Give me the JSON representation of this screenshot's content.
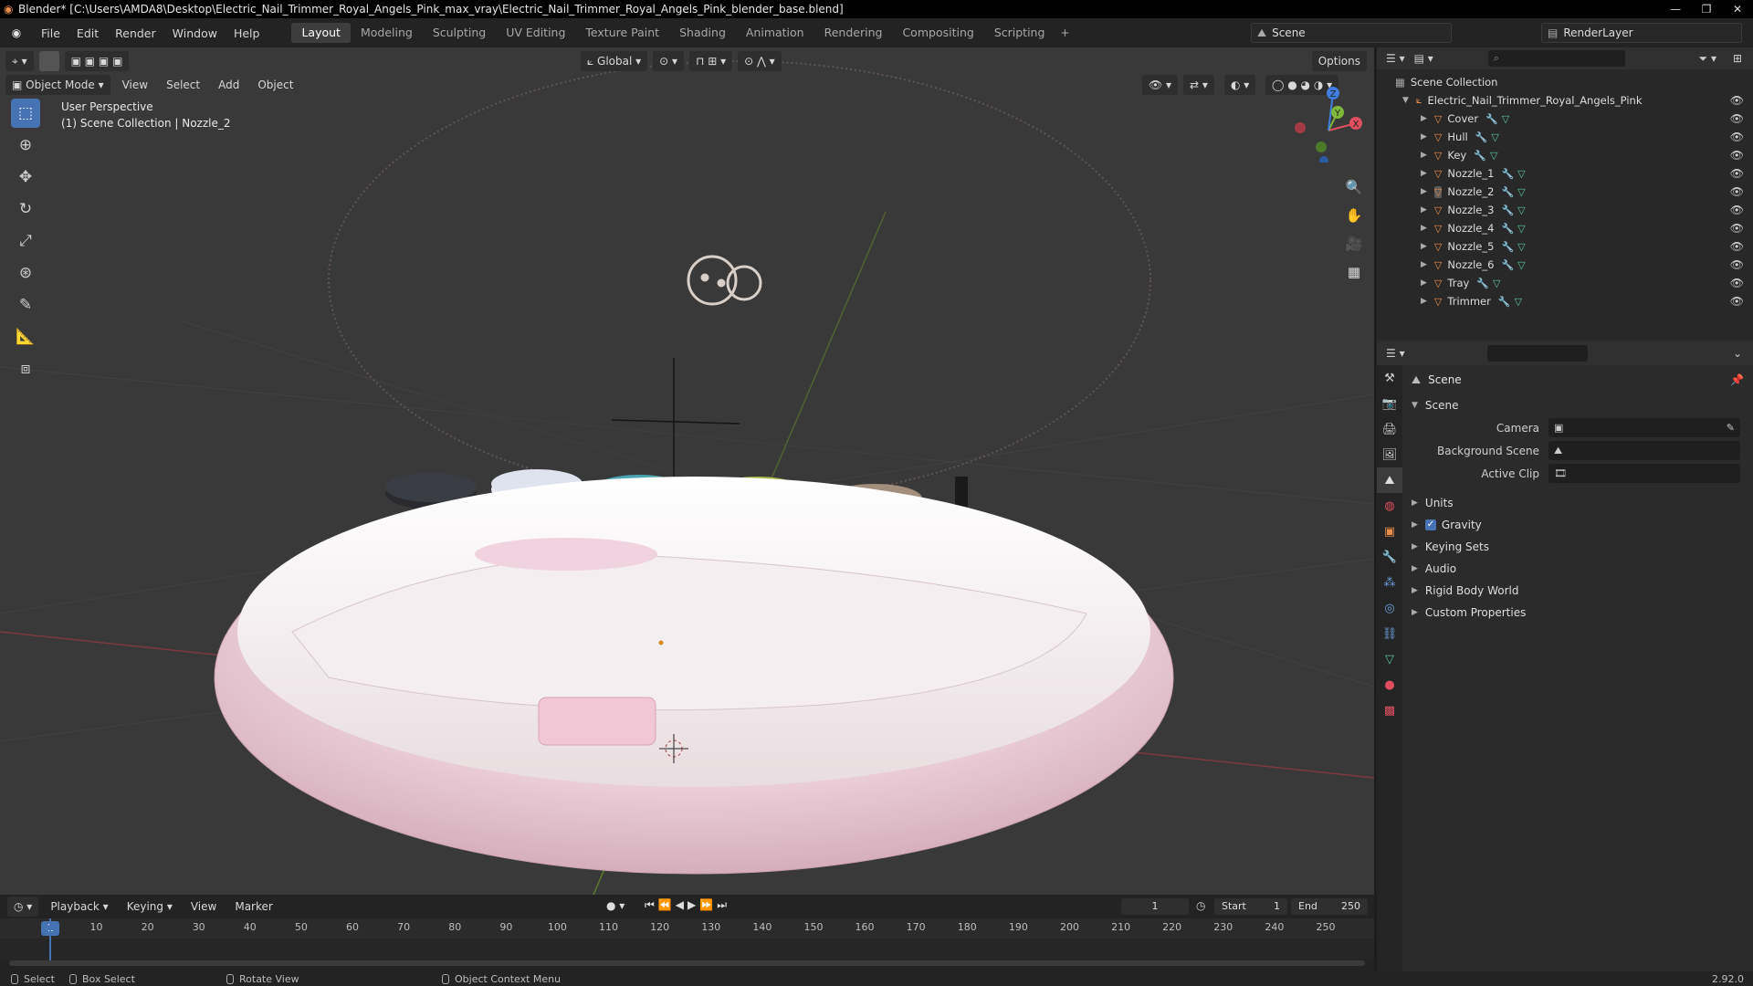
{
  "window": {
    "title": "Blender* [C:\\Users\\AMDA8\\Desktop\\Electric_Nail_Trimmer_Royal_Angels_Pink_max_vray\\Electric_Nail_Trimmer_Royal_Angels_Pink_blender_base.blend]",
    "minimize": "—",
    "maximize": "❐",
    "close": "✕"
  },
  "menu": [
    "File",
    "Edit",
    "Render",
    "Window",
    "Help"
  ],
  "workspaces": [
    "Layout",
    "Modeling",
    "Sculpting",
    "UV Editing",
    "Texture Paint",
    "Shading",
    "Animation",
    "Rendering",
    "Compositing",
    "Scripting"
  ],
  "scene_selector": "Scene",
  "render_layer": "RenderLayer",
  "viewport": {
    "mode": "Object Mode",
    "menus": [
      "View",
      "Select",
      "Add",
      "Object"
    ],
    "orientation": "Global",
    "options": "Options",
    "info_line1": "User Perspective",
    "info_line2": "(1) Scene Collection | Nozzle_2",
    "gizmo": {
      "x": "X",
      "y": "Y",
      "z": "Z"
    }
  },
  "outliner": {
    "root": "Scene Collection",
    "collection": "Electric_Nail_Trimmer_Royal_Angels_Pink",
    "items": [
      "Cover",
      "Hull",
      "Key",
      "Nozzle_1",
      "Nozzle_2",
      "Nozzle_3",
      "Nozzle_4",
      "Nozzle_5",
      "Nozzle_6",
      "Tray",
      "Trimmer"
    ],
    "selected": "Nozzle_2"
  },
  "properties": {
    "context_title": "Scene",
    "panel": "Scene",
    "fields": [
      {
        "label": "Camera",
        "value": ""
      },
      {
        "label": "Background Scene",
        "value": ""
      },
      {
        "label": "Active Clip",
        "value": ""
      }
    ],
    "sections": [
      "Units",
      "Gravity",
      "Keying Sets",
      "Audio",
      "Rigid Body World",
      "Custom Properties"
    ],
    "gravity_checked": true
  },
  "timeline": {
    "menus": [
      "Playback",
      "Keying",
      "View",
      "Marker"
    ],
    "current_frame": "1",
    "start_label": "Start",
    "start": "1",
    "end_label": "End",
    "end": "250",
    "ticks": [
      "1",
      "10",
      "20",
      "30",
      "40",
      "50",
      "60",
      "70",
      "80",
      "90",
      "100",
      "110",
      "120",
      "130",
      "140",
      "150",
      "160",
      "170",
      "180",
      "190",
      "200",
      "210",
      "220",
      "230",
      "240",
      "250"
    ]
  },
  "status": {
    "select": "Select",
    "box_select": "Box Select",
    "rotate": "Rotate View",
    "context_menu": "Object Context Menu",
    "version": "2.92.0"
  },
  "colors": {
    "accent": "#4772b3",
    "object_icon": "#e98d4a",
    "modifier_icon": "#6f9fe0",
    "mesh_icon": "#5ec49a",
    "x_axis": "#e04f5f",
    "y_axis": "#7fb83a",
    "z_axis": "#3f7ee0"
  }
}
